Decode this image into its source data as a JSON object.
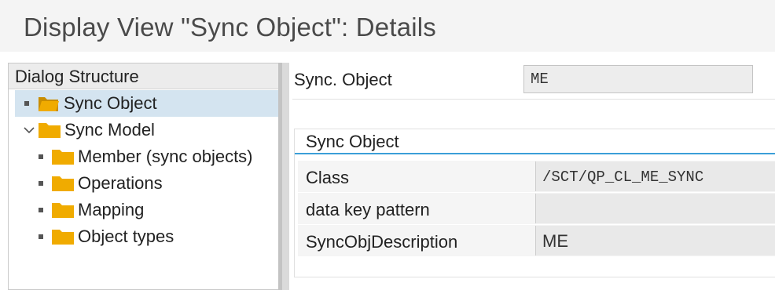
{
  "header": {
    "title": "Display View \"Sync Object\": Details"
  },
  "tree": {
    "header": "Dialog Structure",
    "items": [
      {
        "label": "Sync Object",
        "level": 0,
        "selected": true,
        "expander": "bullet",
        "icon": "open-folder-icon"
      },
      {
        "label": "Sync Model",
        "level": 0,
        "selected": false,
        "expander": "chevron-down",
        "icon": "folder-icon"
      },
      {
        "label": "Member (sync objects)",
        "level": 1,
        "selected": false,
        "expander": "bullet",
        "icon": "folder-icon"
      },
      {
        "label": "Operations",
        "level": 1,
        "selected": false,
        "expander": "bullet",
        "icon": "folder-icon"
      },
      {
        "label": "Mapping",
        "level": 1,
        "selected": false,
        "expander": "bullet",
        "icon": "folder-icon"
      },
      {
        "label": "Object types",
        "level": 1,
        "selected": false,
        "expander": "bullet",
        "icon": "folder-icon"
      }
    ]
  },
  "key": {
    "label": "Sync. Object",
    "value": "ME"
  },
  "group": {
    "title": "Sync Object",
    "fields": [
      {
        "label": "Class",
        "value": "/SCT/QP_CL_ME_SYNC"
      },
      {
        "label": "data key pattern",
        "value": ""
      },
      {
        "label": "SyncObjDescription",
        "value": "ME"
      }
    ]
  },
  "colors": {
    "folder": "#f0ab00",
    "selection": "#d4e4f0",
    "accent": "#3b9fd8"
  }
}
